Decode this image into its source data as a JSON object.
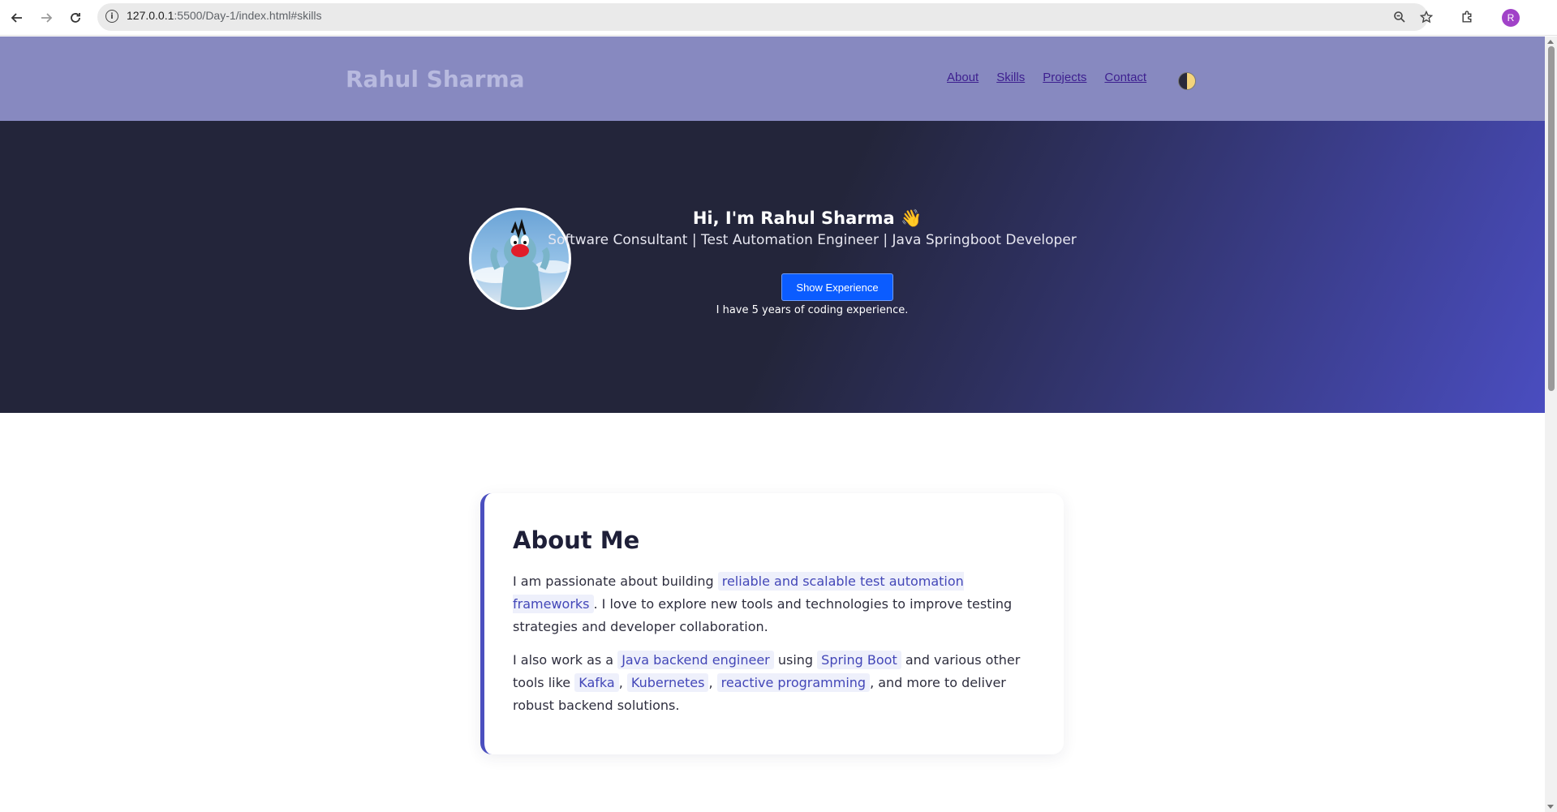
{
  "browser": {
    "url_host": "127.0.0.1",
    "url_path": ":5500/Day-1/index.html#skills",
    "profile_initial": "R"
  },
  "header": {
    "brand": "Rahul Sharma",
    "nav": [
      "About",
      "Skills",
      "Projects",
      "Contact"
    ],
    "theme_toggle_icon": "half-moon-icon"
  },
  "hero": {
    "title": "Hi, I'm Rahul Sharma 👋",
    "subtitle": "Software Consultant | Test Automation Engineer | Java Springboot Developer",
    "button_label": "Show Experience",
    "experience_text": "I have 5 years of coding experience."
  },
  "about": {
    "title": "About Me",
    "p1_a": "I am passionate about building",
    "p1_hl": "reliable and scalable test automation frameworks",
    "p1_b": ". I love to explore new tools and technologies to improve testing strategies and developer collaboration.",
    "p2_a": "I also work as a",
    "p2_hl1": "Java backend engineer",
    "p2_b": "using",
    "p2_hl2": "Spring Boot",
    "p2_c": "and various other tools like",
    "p2_hl3": "Kafka",
    "p2_sep1": ",",
    "p2_hl4": "Kubernetes",
    "p2_sep2": ",",
    "p2_hl5": "reactive programming",
    "p2_d": ", and more to deliver robust backend solutions."
  },
  "colors": {
    "header_bg": "#8789c0",
    "hero_bg": "#23253a",
    "accent": "#4b4fbf",
    "button": "#0b5cff"
  }
}
